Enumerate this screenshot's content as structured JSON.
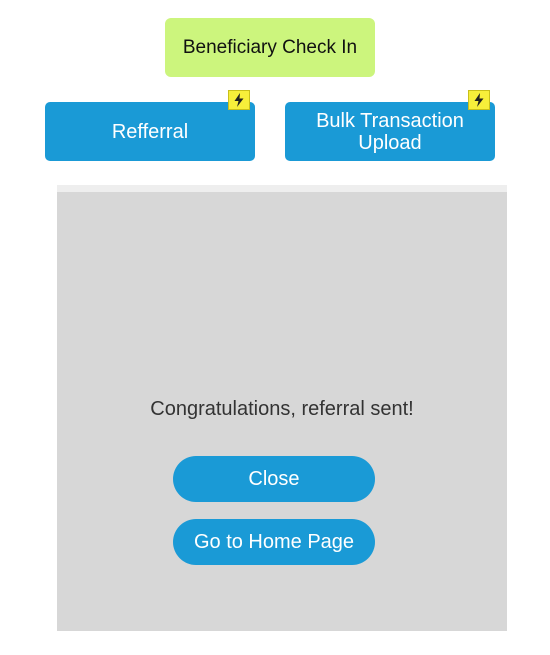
{
  "header": {
    "checkin_label": "Beneficiary Check In"
  },
  "actions": {
    "referral_label": "Refferral",
    "bulk_line1": "Bulk Transaction",
    "bulk_line2": "Upload",
    "badge_icon": "lightning-bolt-icon"
  },
  "dialog": {
    "message": "Congratulations, referral sent!",
    "close_label": "Close",
    "home_label": "Go to Home Page"
  },
  "colors": {
    "checkin_bg": "#ccf57d",
    "primary": "#1a9ad6",
    "badge": "#f7ef3a",
    "panel_bg": "#d7d7d7"
  }
}
